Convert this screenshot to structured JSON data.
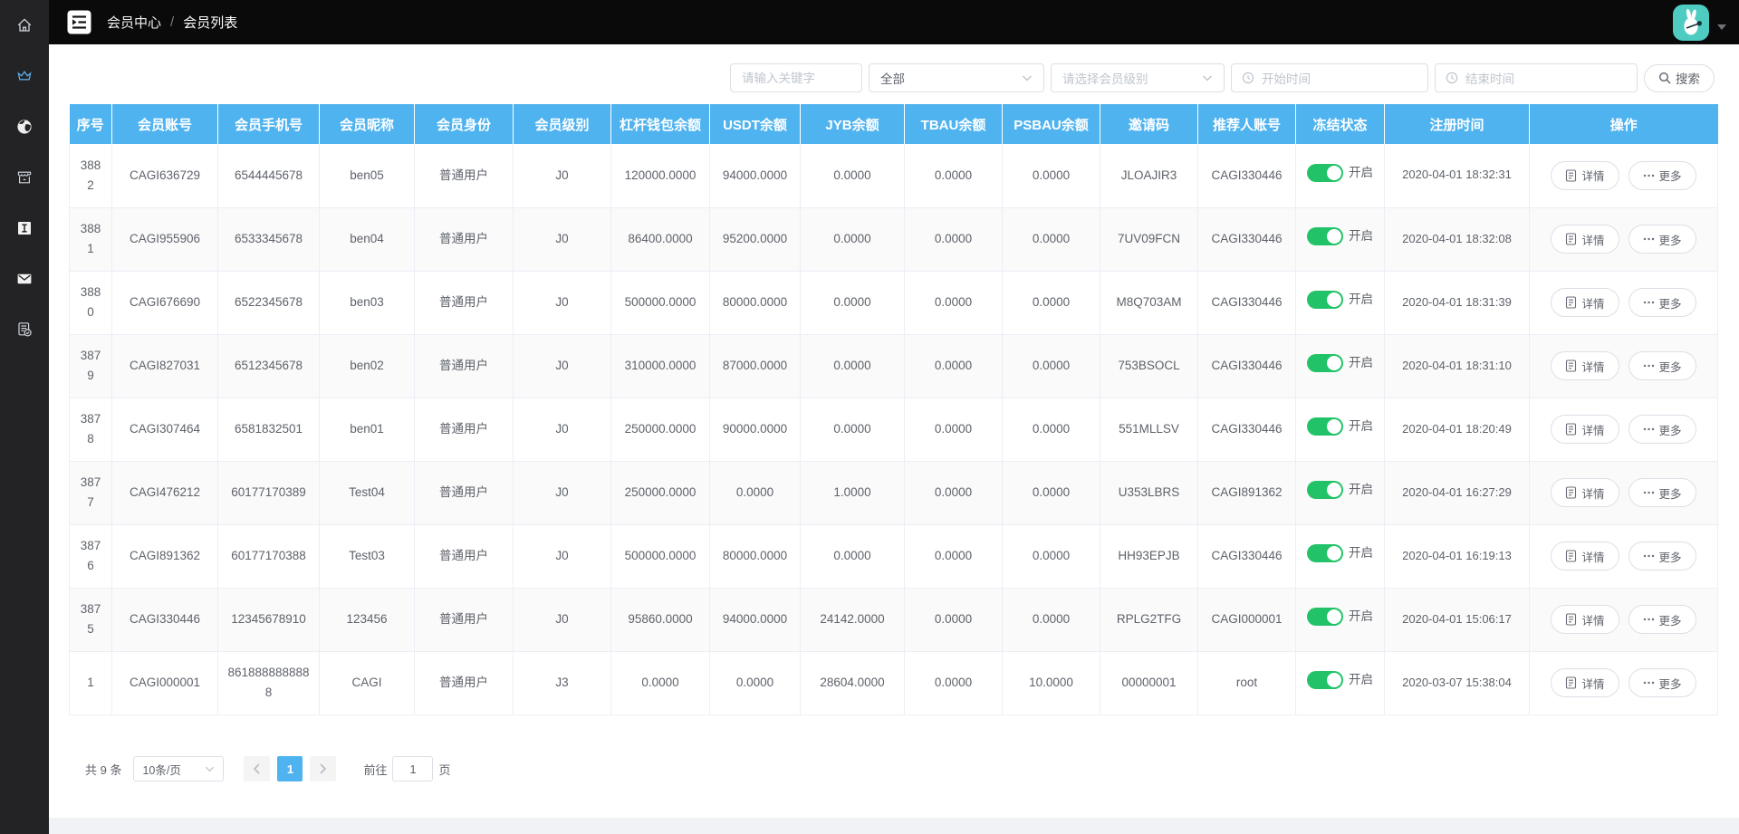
{
  "topbar": {
    "breadcrumb": [
      "会员中心",
      "会员列表"
    ],
    "separator": "/"
  },
  "sidebar": {
    "items": [
      {
        "icon": "home-icon",
        "active": false
      },
      {
        "icon": "crown-icon",
        "active": true
      },
      {
        "icon": "globe-icon",
        "active": false
      },
      {
        "icon": "shop-icon",
        "active": false
      },
      {
        "icon": "italic-i-icon",
        "active": false
      },
      {
        "icon": "mail-icon",
        "active": false
      },
      {
        "icon": "document-check-icon",
        "active": false
      }
    ]
  },
  "filters": {
    "keyword_placeholder": "请输入关键字",
    "status_value": "全部",
    "level_placeholder": "请选择会员级别",
    "start_placeholder": "开始时间",
    "end_placeholder": "结束时间",
    "search_label": "搜索"
  },
  "table": {
    "columns": [
      "序号",
      "会员账号",
      "会员手机号",
      "会员昵称",
      "会员身份",
      "会员级别",
      "杠杆钱包余额",
      "USDT余额",
      "JYB余额",
      "TBAU余额",
      "PSBAU余额",
      "邀请码",
      "推荐人账号",
      "冻结状态",
      "注册时间",
      "操作"
    ],
    "toggle_on_label": "开启",
    "detail_label": "详情",
    "more_label": "更多",
    "rows": [
      {
        "cells": [
          "3882",
          "CAGI636729",
          "6544445678",
          "ben05",
          "普通用户",
          "J0",
          "120000.0000",
          "94000.0000",
          "0.0000",
          "0.0000",
          "0.0000",
          "JLOAJIR3",
          "CAGI330446"
        ],
        "frozen": "开启",
        "registered": "2020-04-01 18:32:31"
      },
      {
        "cells": [
          "3881",
          "CAGI955906",
          "6533345678",
          "ben04",
          "普通用户",
          "J0",
          "86400.0000",
          "95200.0000",
          "0.0000",
          "0.0000",
          "0.0000",
          "7UV09FCN",
          "CAGI330446"
        ],
        "frozen": "开启",
        "registered": "2020-04-01 18:32:08"
      },
      {
        "cells": [
          "3880",
          "CAGI676690",
          "6522345678",
          "ben03",
          "普通用户",
          "J0",
          "500000.0000",
          "80000.0000",
          "0.0000",
          "0.0000",
          "0.0000",
          "M8Q703AM",
          "CAGI330446"
        ],
        "frozen": "开启",
        "registered": "2020-04-01 18:31:39"
      },
      {
        "cells": [
          "3879",
          "CAGI827031",
          "6512345678",
          "ben02",
          "普通用户",
          "J0",
          "310000.0000",
          "87000.0000",
          "0.0000",
          "0.0000",
          "0.0000",
          "753BSOCL",
          "CAGI330446"
        ],
        "frozen": "开启",
        "registered": "2020-04-01 18:31:10"
      },
      {
        "cells": [
          "3878",
          "CAGI307464",
          "6581832501",
          "ben01",
          "普通用户",
          "J0",
          "250000.0000",
          "90000.0000",
          "0.0000",
          "0.0000",
          "0.0000",
          "551MLLSV",
          "CAGI330446"
        ],
        "frozen": "开启",
        "registered": "2020-04-01 18:20:49"
      },
      {
        "cells": [
          "3877",
          "CAGI476212",
          "60177170389",
          "Test04",
          "普通用户",
          "J0",
          "250000.0000",
          "0.0000",
          "1.0000",
          "0.0000",
          "0.0000",
          "U353LBRS",
          "CAGI891362"
        ],
        "frozen": "开启",
        "registered": "2020-04-01 16:27:29"
      },
      {
        "cells": [
          "3876",
          "CAGI891362",
          "60177170388",
          "Test03",
          "普通用户",
          "J0",
          "500000.0000",
          "80000.0000",
          "0.0000",
          "0.0000",
          "0.0000",
          "HH93EPJB",
          "CAGI330446"
        ],
        "frozen": "开启",
        "registered": "2020-04-01 16:19:13"
      },
      {
        "cells": [
          "3875",
          "CAGI330446",
          "12345678910",
          "123456",
          "普通用户",
          "J0",
          "95860.0000",
          "94000.0000",
          "24142.0000",
          "0.0000",
          "0.0000",
          "RPLG2TFG",
          "CAGI000001"
        ],
        "frozen": "开启",
        "registered": "2020-04-01 15:06:17"
      },
      {
        "cells": [
          "1",
          "CAGI000001",
          "8618888888888",
          "CAGI",
          "普通用户",
          "J3",
          "0.0000",
          "0.0000",
          "28604.0000",
          "0.0000",
          "10.0000",
          "00000001",
          "root"
        ],
        "frozen": "开启",
        "registered": "2020-03-07 15:38:04"
      }
    ]
  },
  "pagination": {
    "total_label": "共 9 条",
    "page_size_value": "10条/页",
    "current_page": "1",
    "goto_label": "前往",
    "goto_value": "1",
    "page_suffix": "页"
  },
  "colors": {
    "header_blue": "#4fb3ef",
    "active_page_blue": "#4fb3ef",
    "toggle_green": "#22c368",
    "avatar_teal": "#4fccc2",
    "sidebar_active_blue": "#5aa9e6"
  }
}
